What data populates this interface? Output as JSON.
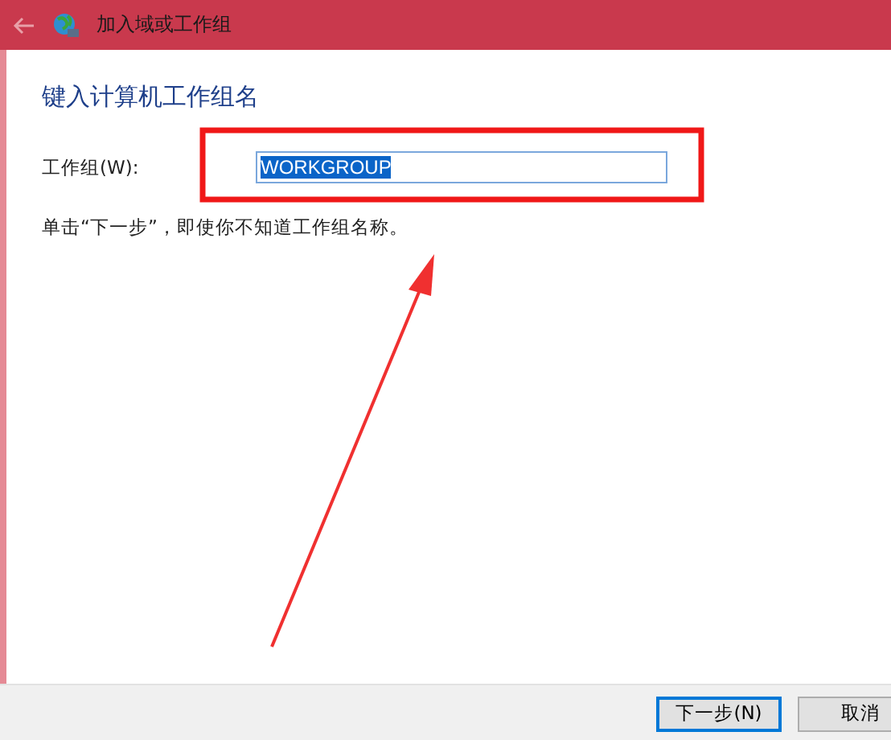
{
  "window": {
    "title": "加入域或工作组"
  },
  "heading": "键入计算机工作组名",
  "workgroup_field": {
    "label": "工作组(W):",
    "value": "WORKGROUP",
    "text_selected": true
  },
  "hint": "单击“下一步”，即使你不知道工作组名称。",
  "buttons": [
    {
      "label": "下一步(N)",
      "kind": "default"
    },
    {
      "label": "取消",
      "kind": "normal"
    }
  ]
}
